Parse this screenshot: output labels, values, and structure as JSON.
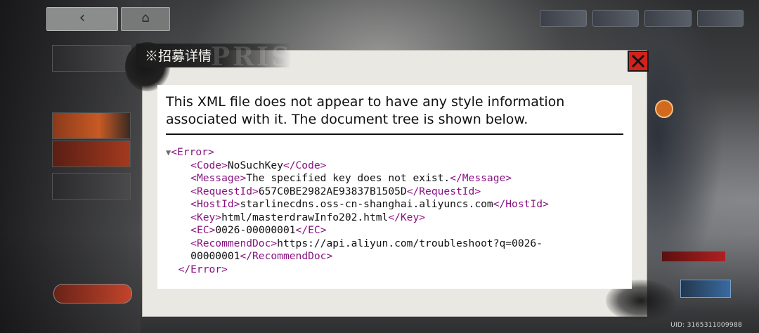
{
  "background": {
    "uid_label": "UID: 3165311009988"
  },
  "dialog": {
    "title": "※招募详情",
    "watermark": "PRIS",
    "close_icon": "close-icon"
  },
  "xml": {
    "header_text": "This XML file does not appear to have any style information associated with it. The document tree is shown below.",
    "lines": [
      {
        "open": "<Error>",
        "text": "",
        "close": ""
      },
      {
        "open": "<Code>",
        "text": "NoSuchKey",
        "close": "</Code>"
      },
      {
        "open": "<Message>",
        "text": "The specified key does not exist.",
        "close": "</Message>"
      },
      {
        "open": "<RequestId>",
        "text": "657C0BE2982AE93837B1505D",
        "close": "</RequestId>"
      },
      {
        "open": "<HostId>",
        "text": "starlinecdns.oss-cn-shanghai.aliyuncs.com",
        "close": "</HostId>"
      },
      {
        "open": "<Key>",
        "text": "html/masterdrawInfo202.html",
        "close": "</Key>"
      },
      {
        "open": "<EC>",
        "text": "0026-00000001",
        "close": "</EC>"
      },
      {
        "open": "<RecommendDoc>",
        "text": "https://api.aliyun.com/troubleshoot?q=0026-",
        "close": ""
      },
      {
        "open": "",
        "text": "00000001",
        "close": "</RecommendDoc>"
      },
      {
        "open": "",
        "text": "",
        "close": "</Error>"
      }
    ],
    "triangle": "▼"
  },
  "colors": {
    "tag": "#881280",
    "close_button": "#d2221b"
  }
}
